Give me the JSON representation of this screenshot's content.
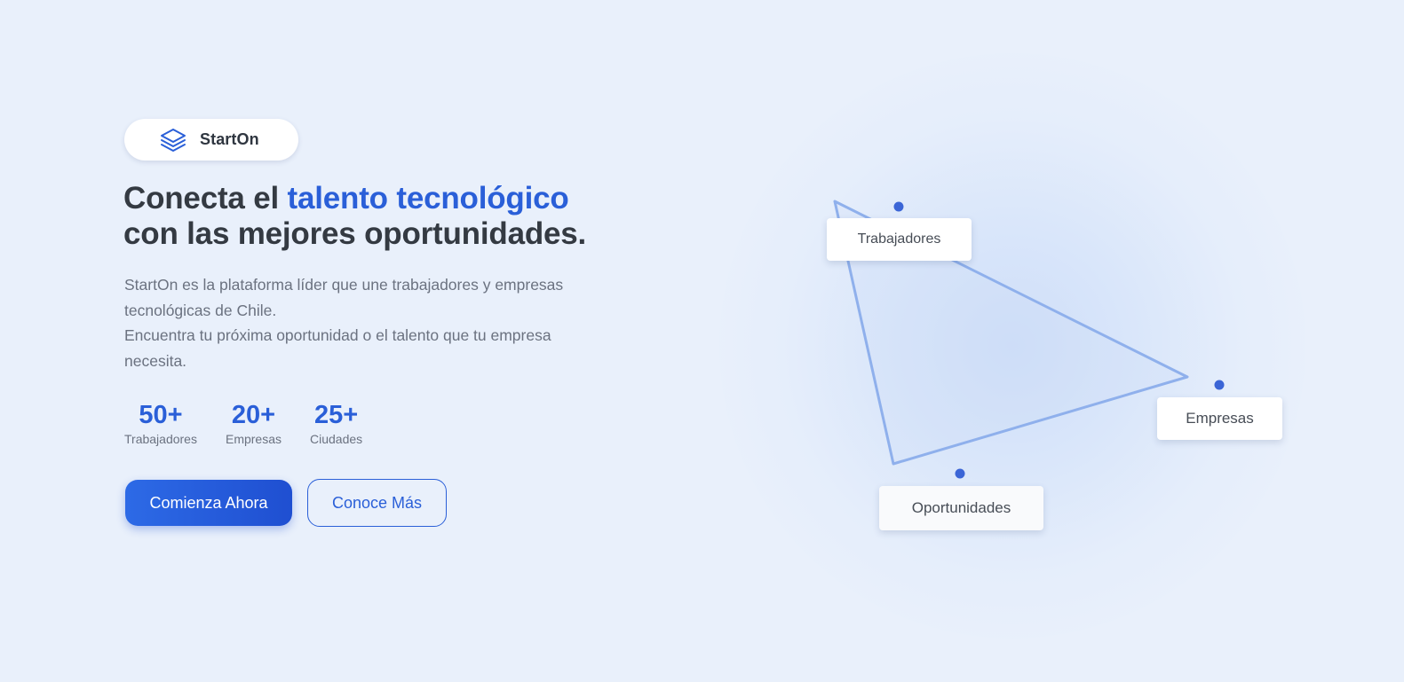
{
  "brand": {
    "name": "StartOn",
    "icon": "stacked-layers-icon"
  },
  "hero": {
    "title_part1": "Conecta el ",
    "title_accent": "talento tecnológico",
    "title_part2": "con las mejores oportunidades.",
    "description_line1": "StartOn es la plataforma líder que une trabajadores y empresas tecnológicas de Chile.",
    "description_line2": "Encuentra tu próxima oportunidad o el talento que tu empresa necesita."
  },
  "stats": [
    {
      "value": "50+",
      "label": "Trabajadores"
    },
    {
      "value": "20+",
      "label": "Empresas"
    },
    {
      "value": "25+",
      "label": "Ciudades"
    }
  ],
  "actions": {
    "primary_label": "Comienza Ahora",
    "secondary_label": "Conoce Más"
  },
  "diagram": {
    "nodes": [
      "Trabajadores",
      "Empresas",
      "Oportunidades"
    ]
  },
  "colors": {
    "background": "#e9f0fb",
    "accent": "#2a5fd8",
    "heading": "#343a42",
    "muted_text": "#6b7280",
    "triangle_stroke": "#8fb0ec",
    "dot": "#3b65d6"
  }
}
